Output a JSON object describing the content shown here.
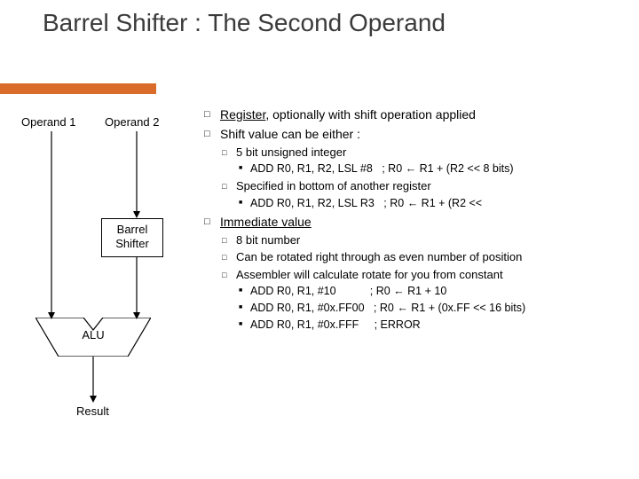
{
  "title": "Barrel Shifter : The Second Operand",
  "diagram": {
    "operand1": "Operand 1",
    "operand2": "Operand 2",
    "barrel_box_l1": "Barrel",
    "barrel_box_l2": "Shifter",
    "alu": "ALU",
    "result": "Result"
  },
  "bullets": {
    "b1_text_pre": "Register",
    "b1_text_post": ", optionally with shift operation applied",
    "b2": "Shift value can be either :",
    "b2a": "5 bit unsigned integer",
    "b2a_i_code": "ADD  R0, R1, R2, LSL #8",
    "b2a_i_cmt": "   ; R0 ← R1 + (R2 << 8 bits)",
    "b2b": "Specified in bottom of another register",
    "b2b_i_code": "ADD  R0, R1, R2, LSL R3",
    "b2b_i_cmt": "   ; R0 ← R1 + (R2 <<",
    "b3": "Immediate value",
    "b3a": "8 bit number",
    "b3b": "Can be rotated right through as even number of position",
    "b3c": "Assembler will calculate rotate for you from constant",
    "b3c_i_code": "ADD  R0, R1, #10",
    "b3c_i_cmt": "           ; R0 ← R1 + 10",
    "b3c_ii_code": "ADD  R0, R1, #0x.FF00",
    "b3c_ii_cmt": "   ; R0 ← R1 + (0x.FF << 16 bits)",
    "b3c_iii_code": "ADD  R0, R1, #0x.FFF",
    "b3c_iii_cmt": "     ; ERROR"
  }
}
